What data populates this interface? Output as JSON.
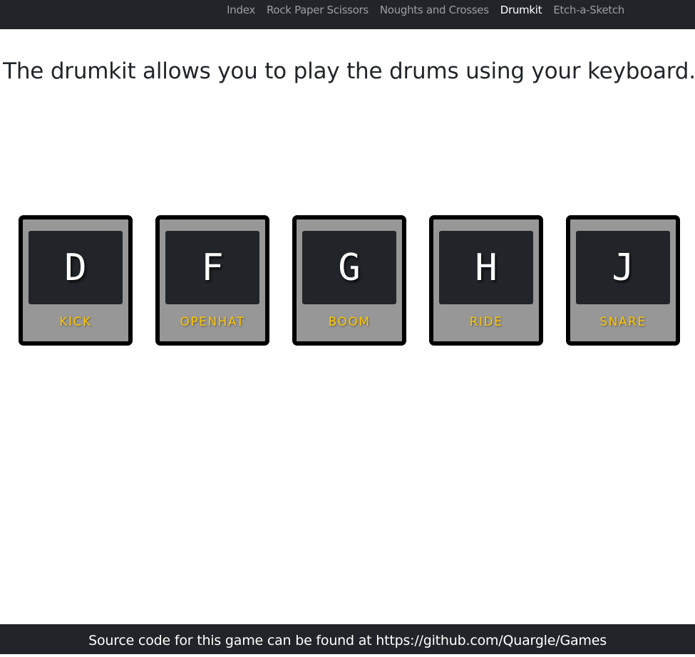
{
  "nav": {
    "links": [
      {
        "label": "Index",
        "active": false
      },
      {
        "label": "Rock Paper Scissors",
        "active": false
      },
      {
        "label": "Noughts and Crosses",
        "active": false
      },
      {
        "label": "Drumkit",
        "active": true
      },
      {
        "label": "Etch-a-Sketch",
        "active": false
      }
    ]
  },
  "heading": "The drumkit allows you to play the drums using your keyboard.",
  "keys": [
    {
      "letter": "D",
      "sound": "KICK"
    },
    {
      "letter": "F",
      "sound": "OPENHAT"
    },
    {
      "letter": "G",
      "sound": "BOOM"
    },
    {
      "letter": "H",
      "sound": "RIDE"
    },
    {
      "letter": "J",
      "sound": "SNARE"
    }
  ],
  "footer": "Source code for this game can be found at https://github.com/Quargle/Games",
  "colors": {
    "navbar_bg": "#212529",
    "key_bg": "#979797",
    "key_face": "#212529",
    "sound_label": "#ffc600"
  }
}
